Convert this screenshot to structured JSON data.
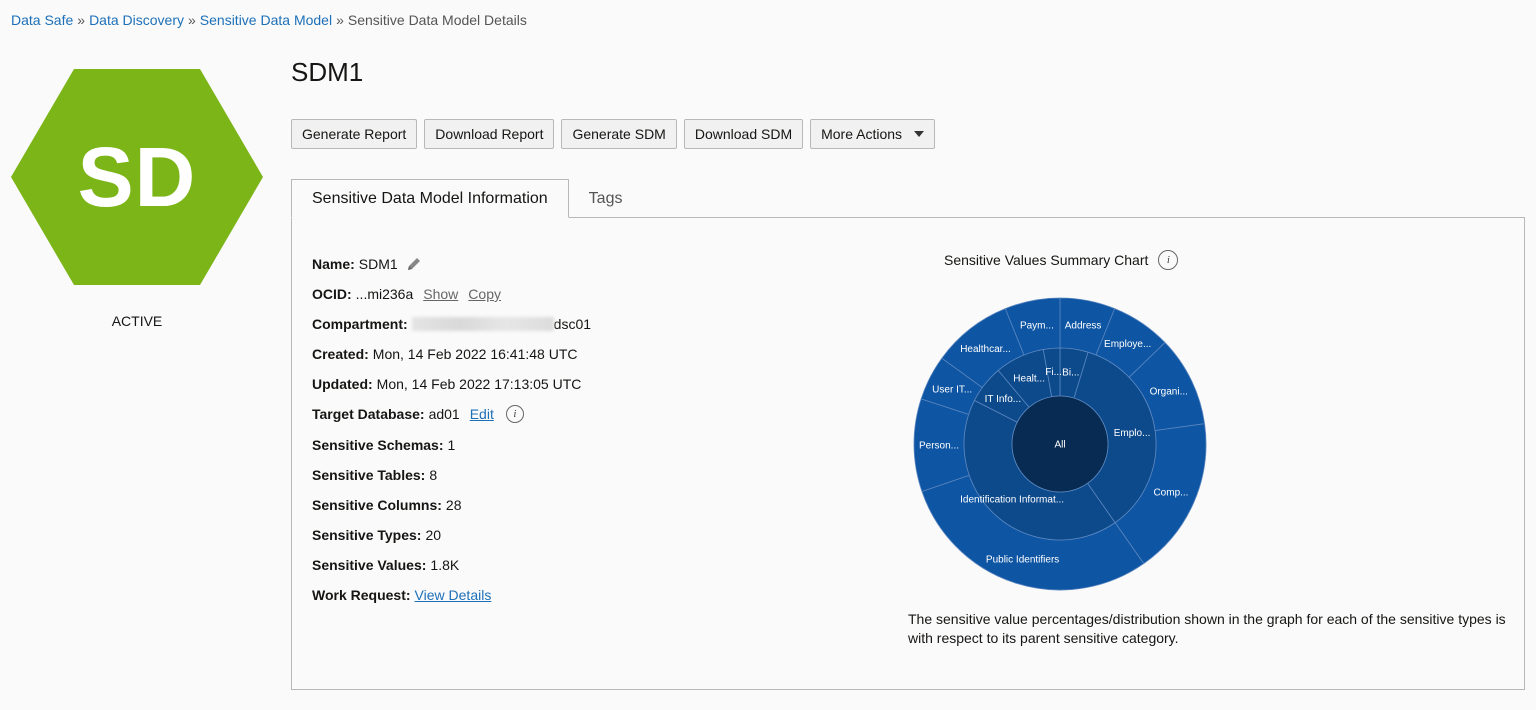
{
  "breadcrumb": {
    "items": [
      "Data Safe",
      "Data Discovery",
      "Sensitive Data Model"
    ],
    "current": "Sensitive Data Model Details",
    "separator": "»"
  },
  "resource": {
    "badge_text": "SD",
    "badge_color": "#7cb518",
    "status": "ACTIVE",
    "title": "SDM1"
  },
  "actions": {
    "generate_report": "Generate Report",
    "download_report": "Download Report",
    "generate_sdm": "Generate SDM",
    "download_sdm": "Download SDM",
    "more_actions": "More Actions"
  },
  "tabs": {
    "info": "Sensitive Data Model Information",
    "tags": "Tags"
  },
  "details": {
    "name_label": "Name:",
    "name_value": "SDM1",
    "ocid_label": "OCID:",
    "ocid_value": "...mi236a",
    "ocid_show": "Show",
    "ocid_copy": "Copy",
    "compartment_label": "Compartment:",
    "compartment_suffix": "dsc01",
    "created_label": "Created:",
    "created_value": "Mon, 14 Feb 2022 16:41:48 UTC",
    "updated_label": "Updated:",
    "updated_value": "Mon, 14 Feb 2022 17:13:05 UTC",
    "target_label": "Target Database:",
    "target_value": "ad01",
    "target_edit": "Edit",
    "schemas_label": "Sensitive Schemas:",
    "schemas_value": "1",
    "tables_label": "Sensitive Tables:",
    "tables_value": "8",
    "columns_label": "Sensitive Columns:",
    "columns_value": "28",
    "types_label": "Sensitive Types:",
    "types_value": "20",
    "values_label": "Sensitive Values:",
    "values_value": "1.8K",
    "work_label": "Work Request:",
    "work_link": "View Details"
  },
  "chart": {
    "title": "Sensitive Values Summary Chart",
    "note": "The sensitive value percentages/distribution shown in the graph for each of the sensitive types is with respect to its parent sensitive category.",
    "center_label": "All",
    "colors": {
      "inner": "#0a3a6e",
      "mid": "#0d4a8c",
      "outer": "#0e55a3",
      "center": "#072b52",
      "stroke": "#5a86bf"
    },
    "mid_ring": [
      {
        "label": "Bi...",
        "start": 0,
        "end": 17
      },
      {
        "label": "Emplo...",
        "start": 17,
        "end": 145
      },
      {
        "label": "Identification Informat...",
        "start": 145,
        "end": 297
      },
      {
        "label": "IT Info...",
        "start": 297,
        "end": 320
      },
      {
        "label": "Healt...",
        "start": 320,
        "end": 350
      },
      {
        "label": "Fi...",
        "start": 350,
        "end": 360
      }
    ],
    "outer_ring": [
      {
        "label": "Address",
        "start": 0,
        "end": 22
      },
      {
        "label": "Employe...",
        "start": 22,
        "end": 46
      },
      {
        "label": "Organi...",
        "start": 46,
        "end": 82
      },
      {
        "label": "Comp...",
        "start": 82,
        "end": 145
      },
      {
        "label": "Public Identifiers",
        "start": 145,
        "end": 251
      },
      {
        "label": "Person...",
        "start": 251,
        "end": 288
      },
      {
        "label": "User IT...",
        "start": 288,
        "end": 306
      },
      {
        "label": "Healthcar...",
        "start": 306,
        "end": 338
      },
      {
        "label": "Paym...",
        "start": 338,
        "end": 360
      }
    ]
  }
}
